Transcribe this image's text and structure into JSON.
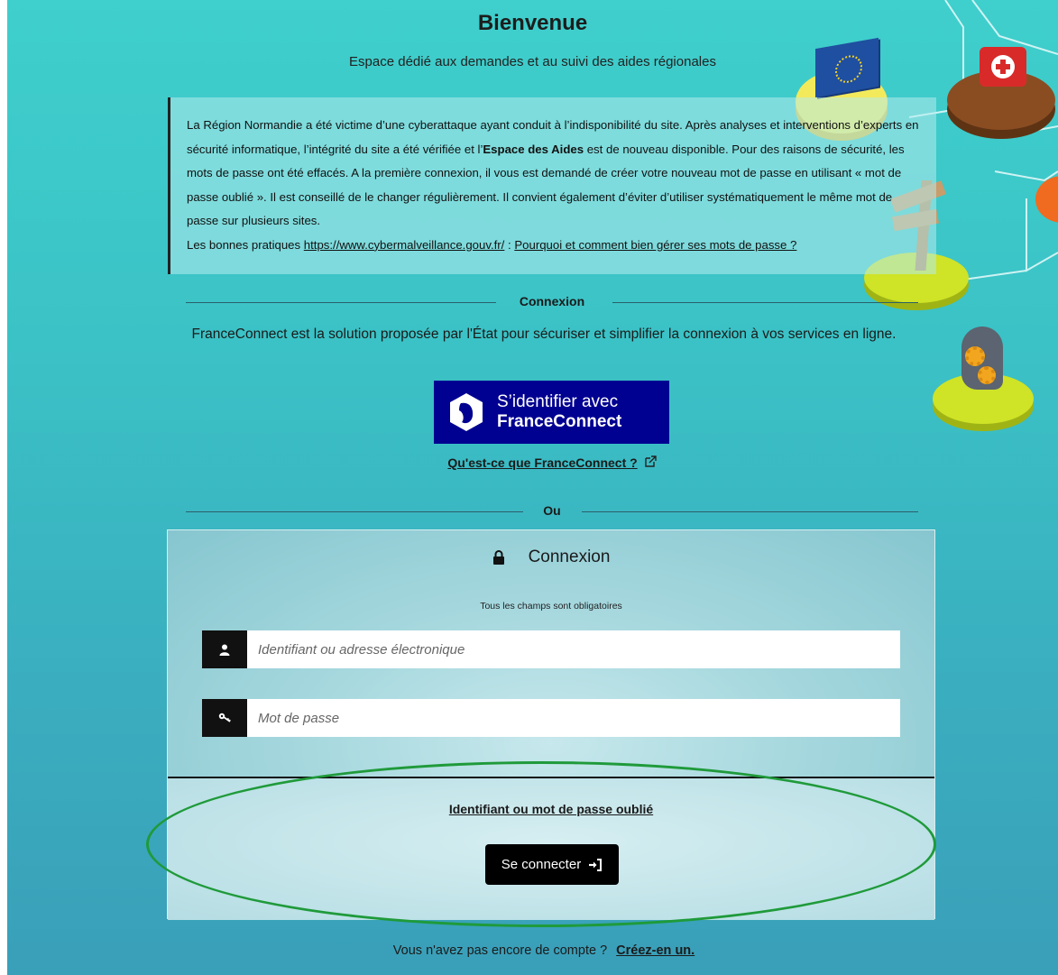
{
  "header": {
    "title": "Bienvenue",
    "subtitle": "Espace dédié aux demandes et au suivi des aides régionales"
  },
  "notice": {
    "text_1": "La Région Normandie a été victime d’une cyberattaque ayant conduit à l’indisponibilité du site. Après analyses et interventions d’experts en sécurité informatique, l’intégrité du site a été vérifiée et l’",
    "bold": "Espace des Aides",
    "text_2": " est de nouveau disponible. Pour des raisons de sécurité, les mots de passe ont été effacés. A la première connexion, il vous est demandé de créer votre nouveau mot de passe en utilisant « mot de passe oublié ». Il est conseillé de le changer régulièrement. Il convient également d’éviter d’utiliser systématiquement le même mot de passe sur plusieurs sites.",
    "practices_prefix": "Les bonnes pratiques ",
    "practices_link": "https://www.cybermalveillance.gouv.fr/",
    "practices_sep": " : ",
    "passwords_link": "Pourquoi et comment bien gérer ses mots de passe ?"
  },
  "connexion_separator": "Connexion",
  "franceconnect": {
    "description": "FranceConnect est la solution proposée par l'État pour sécuriser et simplifier la connexion à vos services en ligne.",
    "button_line1": "S’identifier avec",
    "button_line2": "FranceConnect",
    "info_link": "Qu'est-ce que FranceConnect ?",
    "brand_color": "#000091"
  },
  "or_separator": "Ou",
  "login": {
    "heading": "Connexion",
    "required_note": "Tous les champs sont obligatoires",
    "username_placeholder": "Identifiant ou adresse électronique",
    "password_placeholder": "Mot de passe",
    "forgot_link": "Identifiant ou mot de passe oublié",
    "submit_label": "Se connecter",
    "icons": [
      "lock-icon",
      "user-icon",
      "key-icon",
      "sign-in-icon"
    ]
  },
  "footer": {
    "text": "Vous n'avez pas encore de compte ?",
    "create_link": "Créez-en un."
  },
  "colors": {
    "background_top": "#3fcfcc",
    "background_bottom": "#3a9fb9",
    "highlight_ellipse": "#1f9a3a"
  }
}
